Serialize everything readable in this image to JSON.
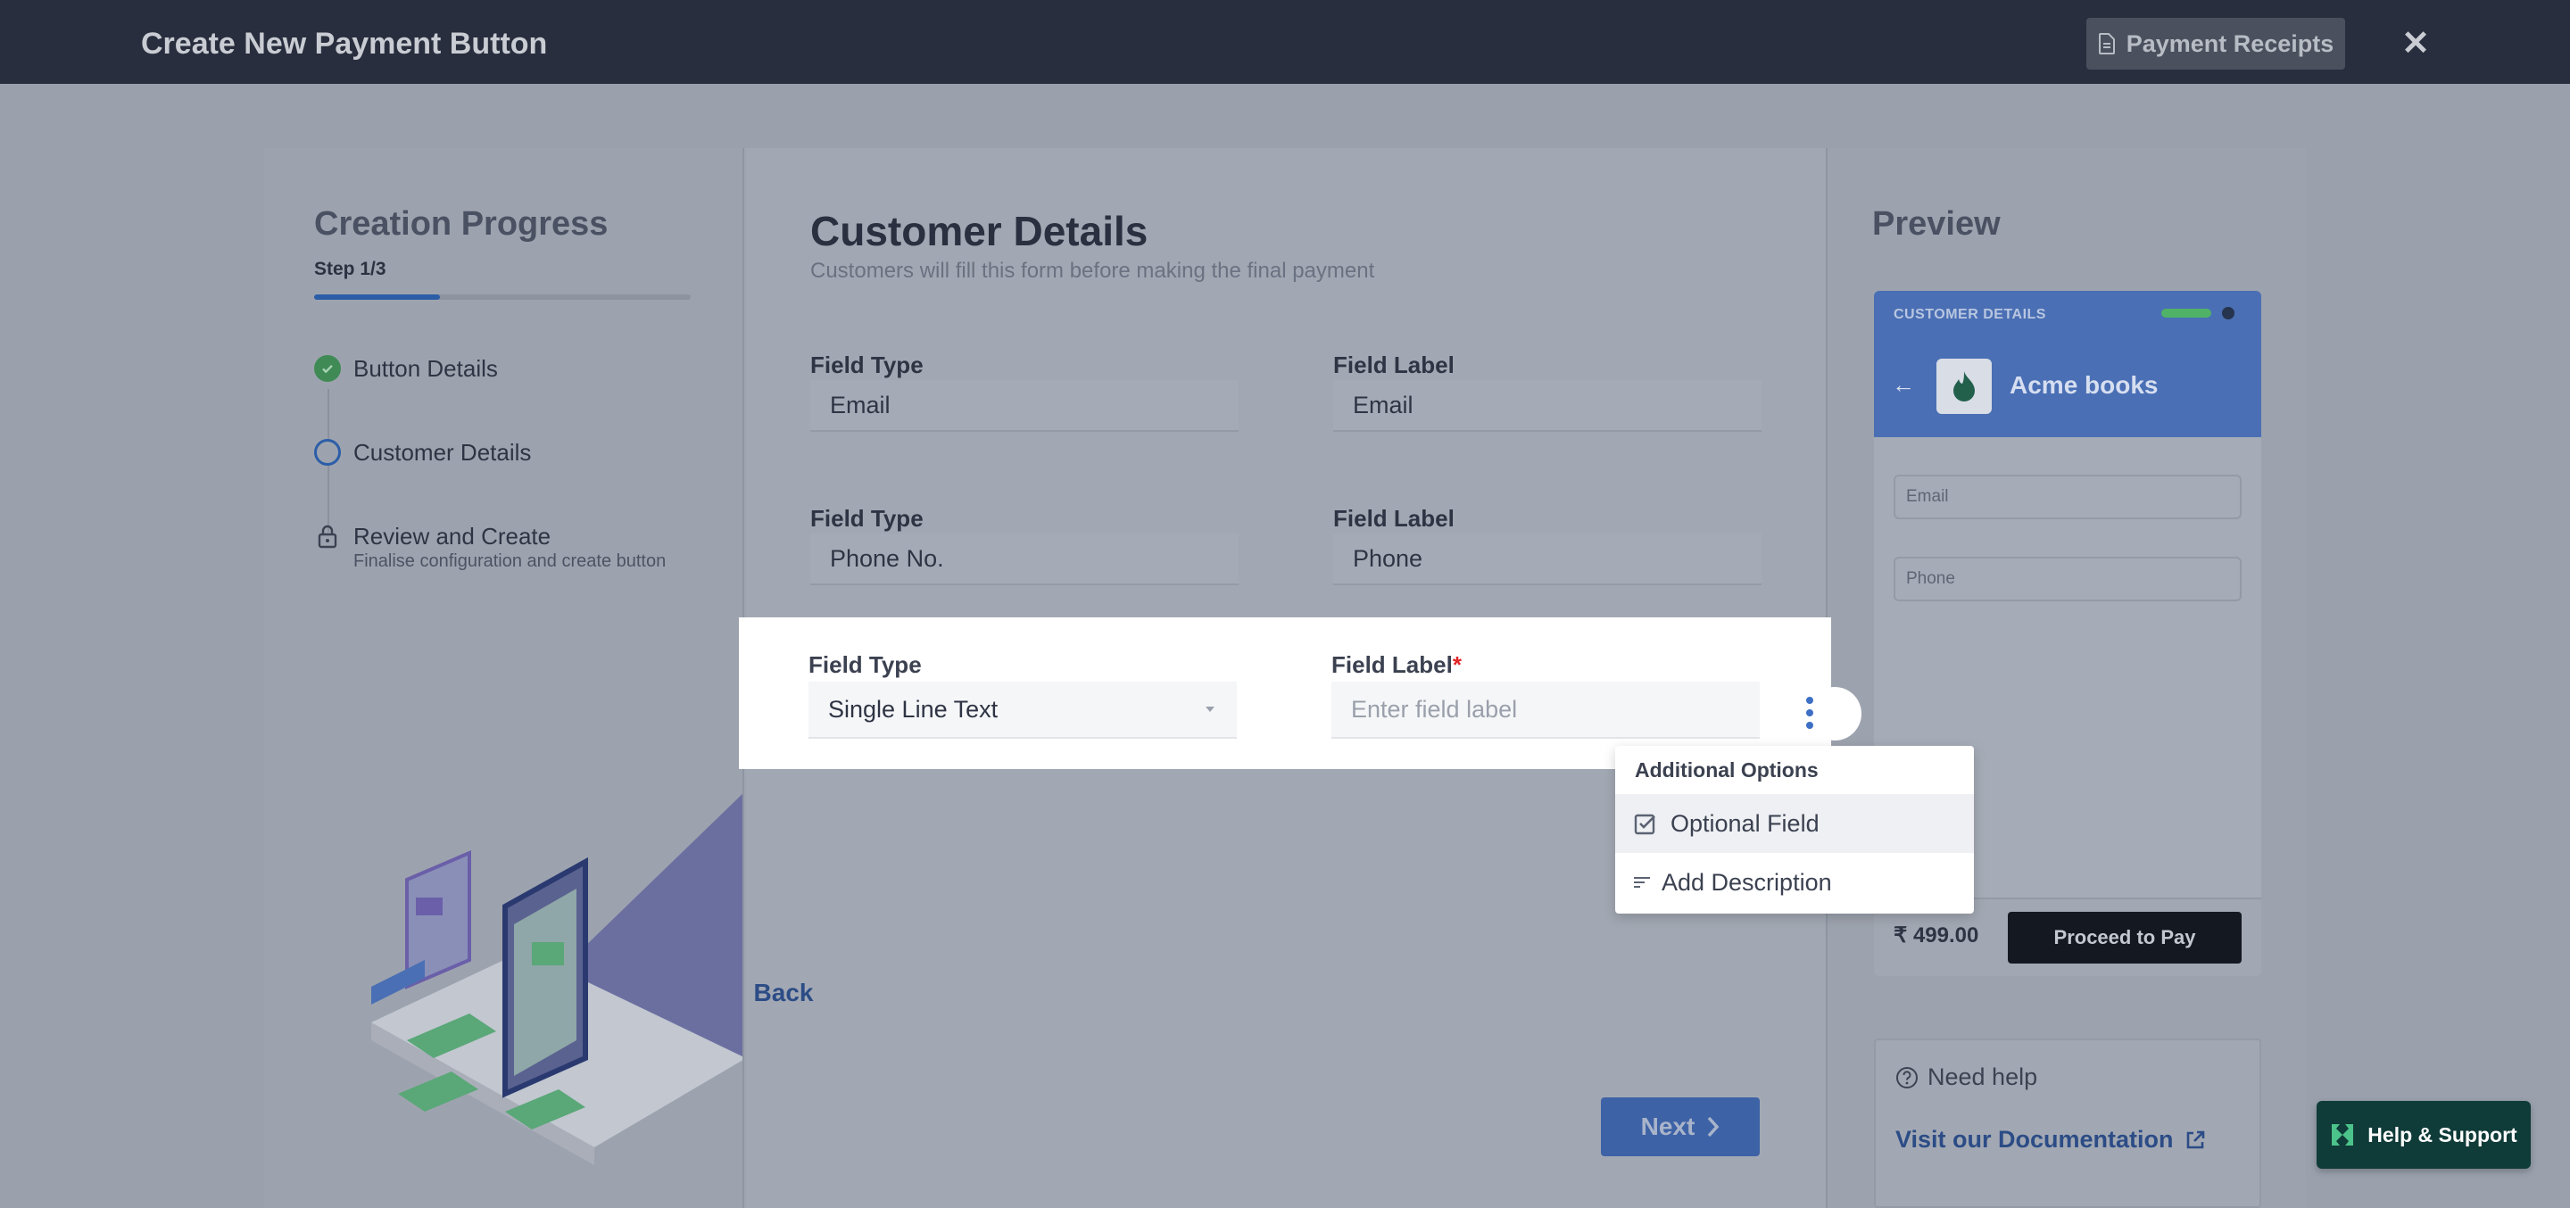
{
  "topbar": {
    "title": "Create New Payment Button",
    "receipts_label": "Payment Receipts",
    "close_symbol": "✕"
  },
  "progress": {
    "title": "Creation Progress",
    "step_label": "Step 1/3",
    "fraction": 0.333,
    "steps": [
      {
        "label": "Button Details",
        "state": "completed",
        "icon": "check-circle-icon"
      },
      {
        "label": "Customer Details",
        "state": "current",
        "icon": "circle-icon"
      },
      {
        "label": "Review and Create",
        "sub": "Finalise configuration and create button",
        "state": "locked",
        "icon": "lock-icon"
      }
    ]
  },
  "form": {
    "title": "Customer Details",
    "subtitle": "Customers will fill this form before making the final payment",
    "rows": [
      {
        "type_label": "Field Type",
        "type_value": "Email",
        "label_label": "Field Label",
        "label_value": "Email"
      },
      {
        "type_label": "Field Type",
        "type_value": "Phone No.",
        "label_label": "Field Label",
        "label_value": "Phone"
      }
    ],
    "active_row": {
      "type_label": "Field Type",
      "type_value": "Single Line Text",
      "label_label": "Field Label",
      "required_mark": "*",
      "label_placeholder": "Enter field label"
    },
    "back_label": "Back",
    "next_label": "Next"
  },
  "menu": {
    "header": "Additional Options",
    "items": [
      {
        "label": "Optional Field",
        "icon": "checkbox-icon"
      },
      {
        "label": "Add Description",
        "icon": "text-lines-icon"
      }
    ]
  },
  "preview": {
    "title": "Preview",
    "header_label": "CUSTOMER DETAILS",
    "merchant": "Acme books",
    "fields": [
      "Email",
      "Phone"
    ],
    "price": "₹ 499.00",
    "pay_label": "Proceed to Pay"
  },
  "help": {
    "need_help": "Need help",
    "doc_link": "Visit our Documentation"
  },
  "support": {
    "label": "Help & Support"
  },
  "colors": {
    "topbar": "#282e3d",
    "primary": "#3e62a6",
    "support": "#0f3b38",
    "success": "#3f8a55",
    "required": "#e02424"
  }
}
